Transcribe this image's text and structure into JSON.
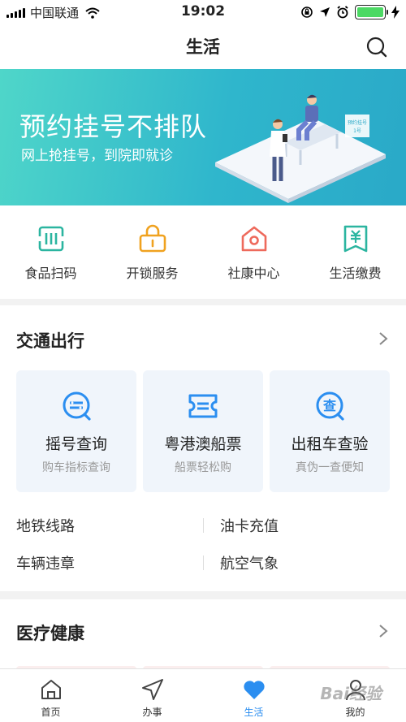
{
  "status_bar": {
    "carrier": "中国联通",
    "time": "19:02"
  },
  "header": {
    "title": "生活",
    "search_icon": "search-icon"
  },
  "banner": {
    "title": "预约挂号不排队",
    "subtitle": "网上抢挂号，到院即就诊",
    "sign_lines": [
      "预约挂号",
      "1号"
    ]
  },
  "quick_services": [
    {
      "label": "食品扫码",
      "icon": "food-scan-icon",
      "color": "#2bb5a0"
    },
    {
      "label": "开锁服务",
      "icon": "lock-icon",
      "color": "#f0a21f"
    },
    {
      "label": "社康中心",
      "icon": "home-clinic-icon",
      "color": "#ee6a5c"
    },
    {
      "label": "生活缴费",
      "icon": "bill-icon",
      "color": "#2bb5a0"
    }
  ],
  "traffic": {
    "title": "交通出行",
    "tiles": [
      {
        "title": "摇号查询",
        "subtitle": "购车指标查询",
        "icon": "lottery-search-icon"
      },
      {
        "title": "粤港澳船票",
        "subtitle": "船票轻松购",
        "icon": "ticket-icon"
      },
      {
        "title": "出租车查验",
        "subtitle": "真伪一查便知",
        "icon": "taxi-check-icon"
      }
    ],
    "links": [
      [
        "地铁线路",
        "油卡充值"
      ],
      [
        "车辆违章",
        "航空气象"
      ]
    ]
  },
  "medical": {
    "title": "医疗健康"
  },
  "tabbar": [
    {
      "label": "首页",
      "icon": "home-icon",
      "active": false
    },
    {
      "label": "办事",
      "icon": "navigation-icon",
      "active": false
    },
    {
      "label": "生活",
      "icon": "heart-icon",
      "active": true
    },
    {
      "label": "我的",
      "icon": "user-icon",
      "active": false
    }
  ],
  "watermark": "Bai经验",
  "colors": {
    "accent_blue": "#2b8ef0",
    "banner_start": "#4fd6c9",
    "banner_end": "#2aa9c8"
  }
}
